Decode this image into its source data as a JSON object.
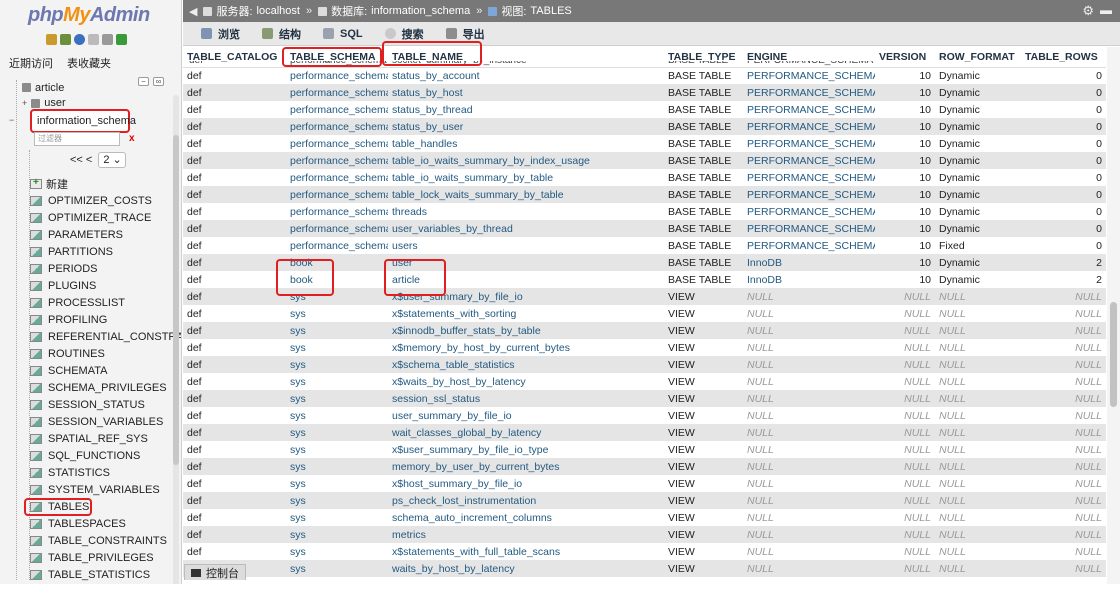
{
  "app": {
    "logo_php": "php",
    "logo_my": "My",
    "logo_admin": "Admin"
  },
  "sidebar": {
    "tabs": [
      "近期访问",
      "表收藏夹"
    ],
    "databases": [
      "article",
      "user"
    ],
    "selected_db": "information_schema",
    "filter_placeholder": "过滤器",
    "filter_clear": "x",
    "pager_prev": "<< <",
    "page_value": "2",
    "new_label": "新建",
    "tables": [
      "OPTIMIZER_COSTS",
      "OPTIMIZER_TRACE",
      "PARAMETERS",
      "PARTITIONS",
      "PERIODS",
      "PLUGINS",
      "PROCESSLIST",
      "PROFILING",
      "REFERENTIAL_CONSTRA",
      "ROUTINES",
      "SCHEMATA",
      "SCHEMA_PRIVILEGES",
      "SESSION_STATUS",
      "SESSION_VARIABLES",
      "SPATIAL_REF_SYS",
      "SQL_FUNCTIONS",
      "STATISTICS",
      "SYSTEM_VARIABLES",
      "TABLES",
      "TABLESPACES",
      "TABLE_CONSTRAINTS",
      "TABLE_PRIVILEGES",
      "TABLE_STATISTICS"
    ]
  },
  "breadcrumb": {
    "server_label": "服务器:",
    "server": "localhost",
    "db_label": "数据库:",
    "db": "information_schema",
    "view_label": "视图:",
    "view": "TABLES"
  },
  "menu": [
    "浏览",
    "结构",
    "SQL",
    "搜索",
    "导出"
  ],
  "grid": {
    "columns": [
      "TABLE_CATALOG",
      "TABLE_SCHEMA",
      "TABLE_NAME",
      "TABLE_TYPE",
      "ENGINE",
      "VERSION",
      "ROW_FORMAT",
      "TABLE_ROWS"
    ],
    "partial_top_row": [
      "def",
      "performance_schema",
      "socket_summary_by_instance",
      "BASE TABLE",
      "PERFORMANCE_SCHEMA",
      "",
      "",
      ""
    ],
    "rows": [
      [
        "def",
        "performance_schema",
        "status_by_account",
        "BASE TABLE",
        "PERFORMANCE_SCHEMA",
        "10",
        "Dynamic",
        "0"
      ],
      [
        "def",
        "performance_schema",
        "status_by_host",
        "BASE TABLE",
        "PERFORMANCE_SCHEMA",
        "10",
        "Dynamic",
        "0"
      ],
      [
        "def",
        "performance_schema",
        "status_by_thread",
        "BASE TABLE",
        "PERFORMANCE_SCHEMA",
        "10",
        "Dynamic",
        "0"
      ],
      [
        "def",
        "performance_schema",
        "status_by_user",
        "BASE TABLE",
        "PERFORMANCE_SCHEMA",
        "10",
        "Dynamic",
        "0"
      ],
      [
        "def",
        "performance_schema",
        "table_handles",
        "BASE TABLE",
        "PERFORMANCE_SCHEMA",
        "10",
        "Dynamic",
        "0"
      ],
      [
        "def",
        "performance_schema",
        "table_io_waits_summary_by_index_usage",
        "BASE TABLE",
        "PERFORMANCE_SCHEMA",
        "10",
        "Dynamic",
        "0"
      ],
      [
        "def",
        "performance_schema",
        "table_io_waits_summary_by_table",
        "BASE TABLE",
        "PERFORMANCE_SCHEMA",
        "10",
        "Dynamic",
        "0"
      ],
      [
        "def",
        "performance_schema",
        "table_lock_waits_summary_by_table",
        "BASE TABLE",
        "PERFORMANCE_SCHEMA",
        "10",
        "Dynamic",
        "0"
      ],
      [
        "def",
        "performance_schema",
        "threads",
        "BASE TABLE",
        "PERFORMANCE_SCHEMA",
        "10",
        "Dynamic",
        "0"
      ],
      [
        "def",
        "performance_schema",
        "user_variables_by_thread",
        "BASE TABLE",
        "PERFORMANCE_SCHEMA",
        "10",
        "Dynamic",
        "0"
      ],
      [
        "def",
        "performance_schema",
        "users",
        "BASE TABLE",
        "PERFORMANCE_SCHEMA",
        "10",
        "Fixed",
        "0"
      ],
      [
        "def",
        "book",
        "user",
        "BASE TABLE",
        "InnoDB",
        "10",
        "Dynamic",
        "2"
      ],
      [
        "def",
        "book",
        "article",
        "BASE TABLE",
        "InnoDB",
        "10",
        "Dynamic",
        "2"
      ],
      [
        "def",
        "sys",
        "x$user_summary_by_file_io",
        "VIEW",
        "NULL",
        "NULL",
        "NULL",
        "NULL"
      ],
      [
        "def",
        "sys",
        "x$statements_with_sorting",
        "VIEW",
        "NULL",
        "NULL",
        "NULL",
        "NULL"
      ],
      [
        "def",
        "sys",
        "x$innodb_buffer_stats_by_table",
        "VIEW",
        "NULL",
        "NULL",
        "NULL",
        "NULL"
      ],
      [
        "def",
        "sys",
        "x$memory_by_host_by_current_bytes",
        "VIEW",
        "NULL",
        "NULL",
        "NULL",
        "NULL"
      ],
      [
        "def",
        "sys",
        "x$schema_table_statistics",
        "VIEW",
        "NULL",
        "NULL",
        "NULL",
        "NULL"
      ],
      [
        "def",
        "sys",
        "x$waits_by_host_by_latency",
        "VIEW",
        "NULL",
        "NULL",
        "NULL",
        "NULL"
      ],
      [
        "def",
        "sys",
        "session_ssl_status",
        "VIEW",
        "NULL",
        "NULL",
        "NULL",
        "NULL"
      ],
      [
        "def",
        "sys",
        "user_summary_by_file_io",
        "VIEW",
        "NULL",
        "NULL",
        "NULL",
        "NULL"
      ],
      [
        "def",
        "sys",
        "wait_classes_global_by_latency",
        "VIEW",
        "NULL",
        "NULL",
        "NULL",
        "NULL"
      ],
      [
        "def",
        "sys",
        "x$user_summary_by_file_io_type",
        "VIEW",
        "NULL",
        "NULL",
        "NULL",
        "NULL"
      ],
      [
        "def",
        "sys",
        "memory_by_user_by_current_bytes",
        "VIEW",
        "NULL",
        "NULL",
        "NULL",
        "NULL"
      ],
      [
        "def",
        "sys",
        "x$host_summary_by_file_io",
        "VIEW",
        "NULL",
        "NULL",
        "NULL",
        "NULL"
      ],
      [
        "def",
        "sys",
        "ps_check_lost_instrumentation",
        "VIEW",
        "NULL",
        "NULL",
        "NULL",
        "NULL"
      ],
      [
        "def",
        "sys",
        "schema_auto_increment_columns",
        "VIEW",
        "NULL",
        "NULL",
        "NULL",
        "NULL"
      ],
      [
        "def",
        "sys",
        "metrics",
        "VIEW",
        "NULL",
        "NULL",
        "NULL",
        "NULL"
      ],
      [
        "def",
        "sys",
        "x$statements_with_full_table_scans",
        "VIEW",
        "NULL",
        "NULL",
        "NULL",
        "NULL"
      ],
      [
        "def",
        "sys",
        "waits_by_host_by_latency",
        "VIEW",
        "NULL",
        "NULL",
        "NULL",
        "NULL"
      ]
    ]
  },
  "console": {
    "label": "控制台"
  },
  "colors": {
    "highlight": "#e02020",
    "link": "#235a81",
    "topbar": "#787878"
  }
}
